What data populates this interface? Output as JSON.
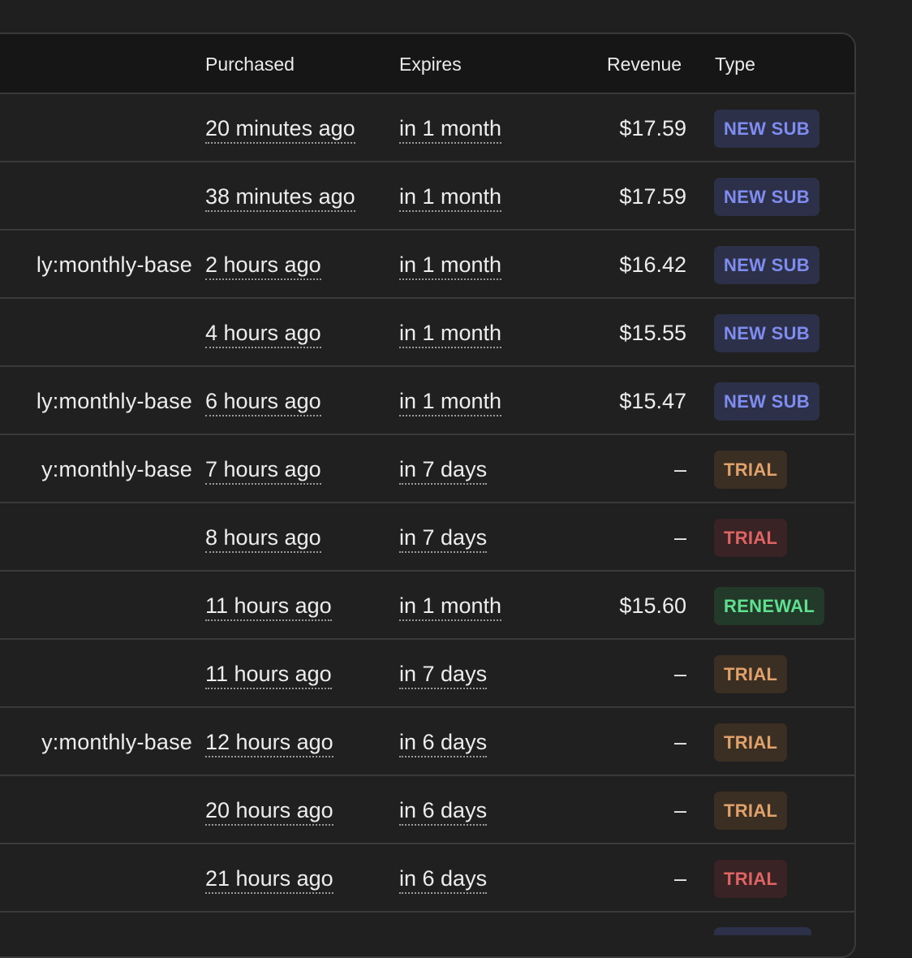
{
  "headers": {
    "purchased": "Purchased",
    "expires": "Expires",
    "revenue": "Revenue",
    "type": "Type"
  },
  "rows": [
    {
      "product": "",
      "purchased": "20 minutes ago",
      "expires": "in 1 month",
      "revenue": "$17.59",
      "type": "NEW SUB",
      "type_variant": "new"
    },
    {
      "product": "",
      "purchased": "38 minutes ago",
      "expires": "in 1 month",
      "revenue": "$17.59",
      "type": "NEW SUB",
      "type_variant": "new"
    },
    {
      "product": "ly:monthly-base",
      "purchased": "2 hours ago",
      "expires": "in 1 month",
      "revenue": "$16.42",
      "type": "NEW SUB",
      "type_variant": "new"
    },
    {
      "product": "",
      "purchased": "4 hours ago",
      "expires": "in 1 month",
      "revenue": "$15.55",
      "type": "NEW SUB",
      "type_variant": "new"
    },
    {
      "product": "ly:monthly-base",
      "purchased": "6 hours ago",
      "expires": "in 1 month",
      "revenue": "$15.47",
      "type": "NEW SUB",
      "type_variant": "new"
    },
    {
      "product": "y:monthly-base",
      "purchased": "7 hours ago",
      "expires": "in 7 days",
      "revenue": "–",
      "type": "TRIAL",
      "type_variant": "trial-orange"
    },
    {
      "product": "",
      "purchased": "8 hours ago",
      "expires": "in 7 days",
      "revenue": "–",
      "type": "TRIAL",
      "type_variant": "trial-red"
    },
    {
      "product": "",
      "purchased": "11 hours ago",
      "expires": "in 1 month",
      "revenue": "$15.60",
      "type": "RENEWAL",
      "type_variant": "renewal"
    },
    {
      "product": "",
      "purchased": "11 hours ago",
      "expires": "in 7 days",
      "revenue": "–",
      "type": "TRIAL",
      "type_variant": "trial-orange"
    },
    {
      "product": "y:monthly-base",
      "purchased": "12 hours ago",
      "expires": "in 6 days",
      "revenue": "–",
      "type": "TRIAL",
      "type_variant": "trial-orange"
    },
    {
      "product": "",
      "purchased": "20 hours ago",
      "expires": "in 6 days",
      "revenue": "–",
      "type": "TRIAL",
      "type_variant": "trial-orange"
    },
    {
      "product": "",
      "purchased": "21 hours ago",
      "expires": "in 6 days",
      "revenue": "–",
      "type": "TRIAL",
      "type_variant": "trial-red"
    }
  ],
  "colors": {
    "new_sub": "#7f8cf0",
    "trial_orange": "#e0a26a",
    "trial_red": "#e06464",
    "renewal": "#5fe08f"
  }
}
